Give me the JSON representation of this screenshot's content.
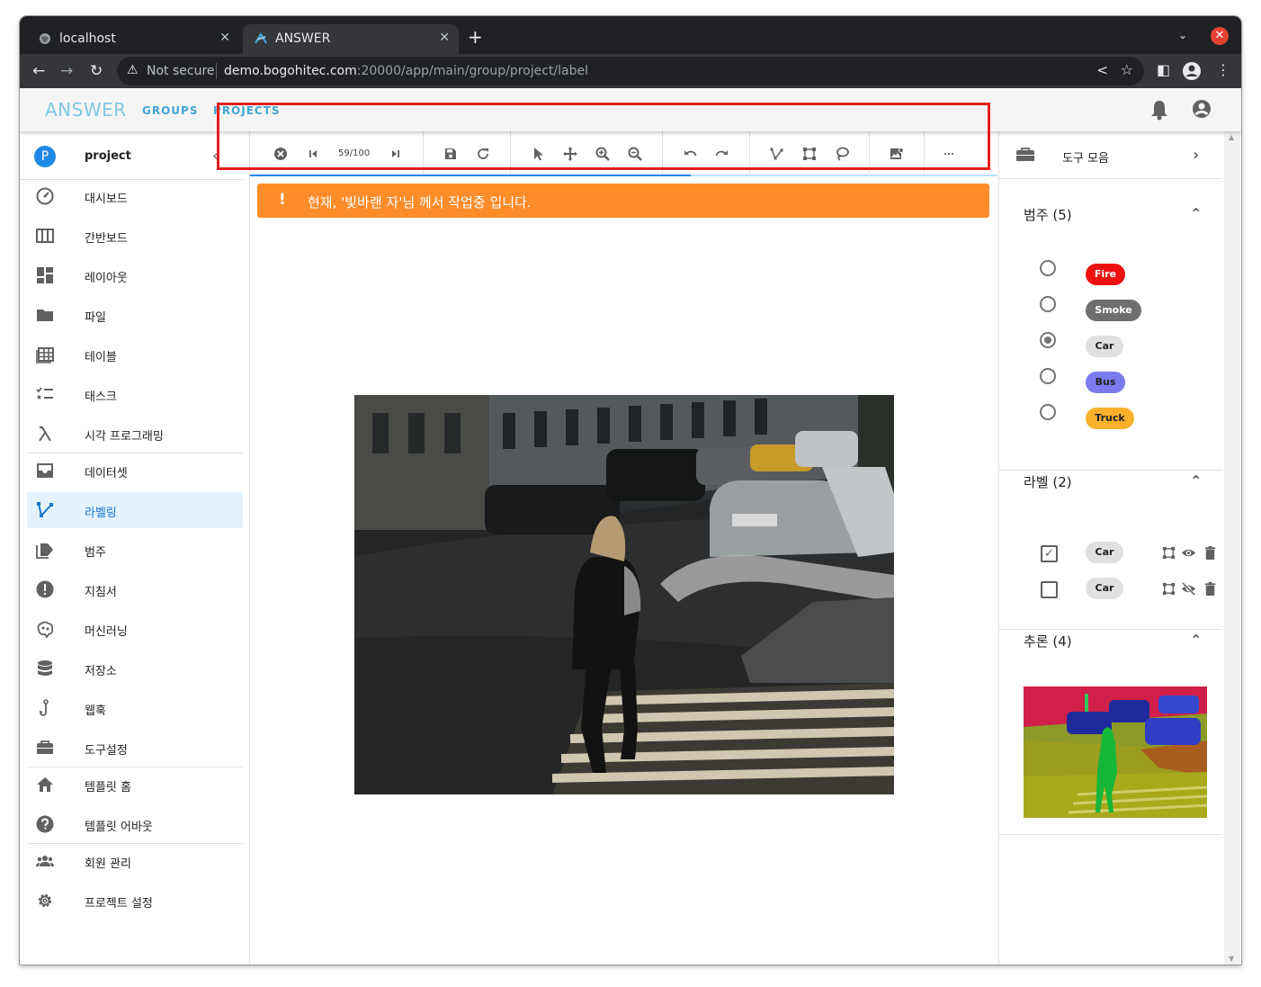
{
  "browser": {
    "tabs": [
      {
        "title": "localhost",
        "active": false
      },
      {
        "title": "ANSWER",
        "active": true
      }
    ],
    "security_label": "Not secure",
    "url_host": "demo.bogohitec.com",
    "url_rest": ":20000/app/main/group/project/label"
  },
  "app": {
    "brand": "ANSWER",
    "nav": [
      "GROUPS",
      "PROJECTS"
    ]
  },
  "sidebar": {
    "project": {
      "initial": "P",
      "name": "project"
    },
    "items": [
      {
        "label": "대시보드",
        "icon": "dashboard-icon"
      },
      {
        "label": "간반보드",
        "icon": "kanban-icon"
      },
      {
        "label": "레이아웃",
        "icon": "layout-icon"
      },
      {
        "label": "파일",
        "icon": "folder-icon"
      },
      {
        "label": "테이블",
        "icon": "table-icon"
      },
      {
        "label": "태스크",
        "icon": "task-icon"
      },
      {
        "label": "시각 프로그래밍",
        "icon": "lambda-icon"
      },
      {
        "label": "데이터셋",
        "icon": "inbox-icon"
      },
      {
        "label": "라벨링",
        "icon": "polyline-icon"
      },
      {
        "label": "범주",
        "icon": "label-icon"
      },
      {
        "label": "지침서",
        "icon": "info-icon"
      },
      {
        "label": "머신러닝",
        "icon": "brain-icon"
      },
      {
        "label": "저장소",
        "icon": "database-icon"
      },
      {
        "label": "웹훅",
        "icon": "hook-icon"
      },
      {
        "label": "도구설정",
        "icon": "toolbox-icon"
      },
      {
        "label": "템플릿 홈",
        "icon": "home-icon"
      },
      {
        "label": "템플릿 어바웃",
        "icon": "help-icon"
      },
      {
        "label": "회원 관리",
        "icon": "people-icon"
      },
      {
        "label": "프로젝트 설정",
        "icon": "gear-icon"
      }
    ],
    "active_item": "라벨링"
  },
  "label_toolbar": {
    "counter": "59/100",
    "progress_fraction": 0.59,
    "tools": [
      "close-icon",
      "first-icon",
      "last-icon",
      "save-icon",
      "refresh-icon",
      "cursor-icon",
      "move-icon",
      "zoom-in-icon",
      "zoom-out-icon",
      "undo-icon",
      "redo-icon",
      "polyline-tool-icon",
      "bbox-tool-icon",
      "lasso-icon",
      "image-settings-icon",
      "more-icon"
    ]
  },
  "notice": {
    "mark": "!",
    "text": "현재, '빛바랜 자'님 께서 작업중 입니다.",
    "color": "#ff8c2a"
  },
  "right_panel": {
    "title": "도구 모음",
    "categories": {
      "title": "범주 (5)",
      "items": [
        {
          "name": "Fire",
          "bg": "#ee1111",
          "fg": "#ffffff",
          "selected": false
        },
        {
          "name": "Smoke",
          "bg": "#6e6e6e",
          "fg": "#ffffff",
          "selected": false
        },
        {
          "name": "Car",
          "bg": "#e0e0e0",
          "fg": "#212121",
          "selected": true
        },
        {
          "name": "Bus",
          "bg": "#7b7bef",
          "fg": "#212121",
          "selected": false
        },
        {
          "name": "Truck",
          "bg": "#fbb12c",
          "fg": "#212121",
          "selected": false
        }
      ]
    },
    "labels": {
      "title": "라벨 (2)",
      "items": [
        {
          "name": "Car",
          "checked": true,
          "visible": true
        },
        {
          "name": "Car",
          "checked": false,
          "visible": false
        }
      ]
    },
    "inference": {
      "title": "추론 (4)"
    }
  }
}
